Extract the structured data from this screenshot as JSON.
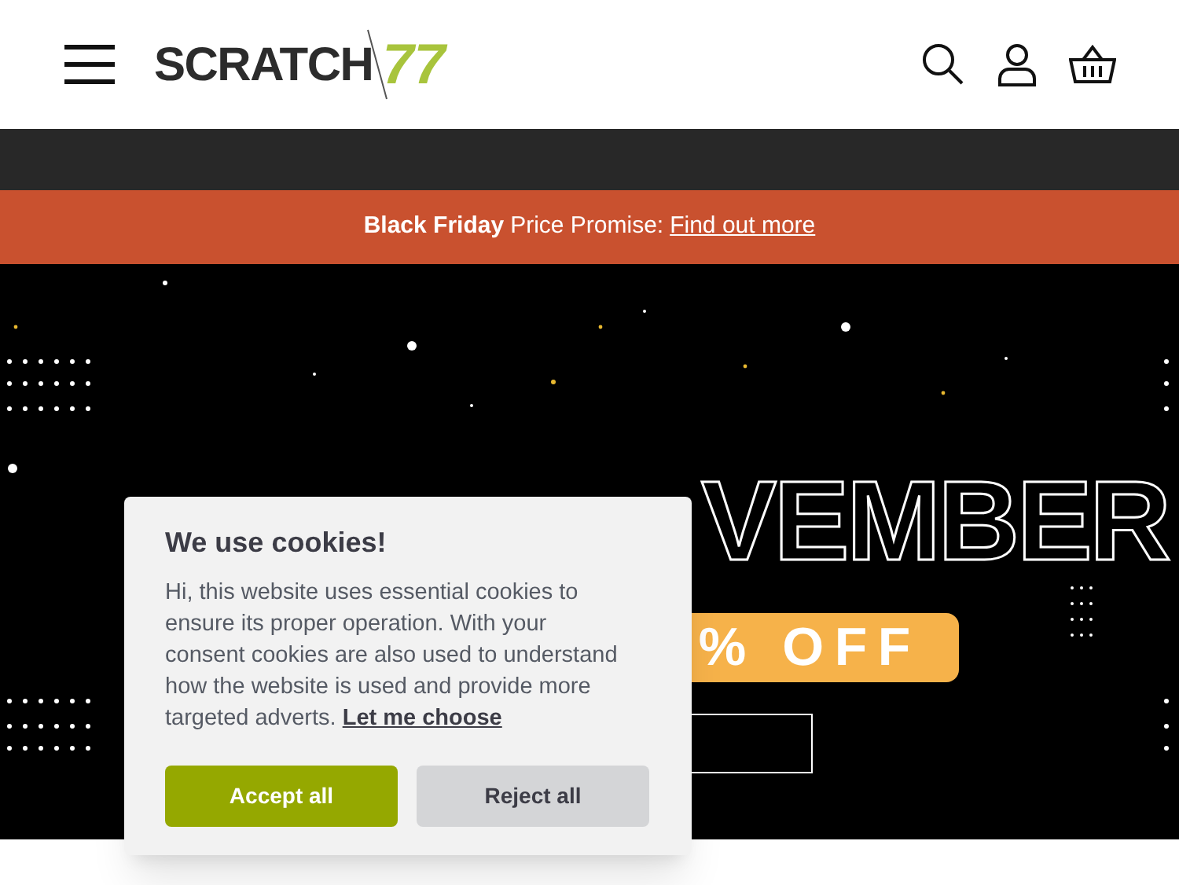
{
  "header": {
    "logo": {
      "text": "SCRATCH",
      "accent": "77"
    }
  },
  "promo_bar": {
    "bold": "Black Friday",
    "text": "Price Promise:",
    "link": "Find out more"
  },
  "hero": {
    "title_outline": "VEMBER",
    "badge": "% OFF"
  },
  "cookie_dialog": {
    "title": "We use cookies!",
    "body": "Hi, this website uses essential cookies to ensure its proper operation. With your consent cookies are also used to understand how the website is used and provide more targeted adverts.",
    "link": "Let me choose",
    "buttons": [
      {
        "label": "Accept all",
        "kind": "primary"
      },
      {
        "label": "Reject all",
        "kind": "secondary"
      }
    ]
  }
}
